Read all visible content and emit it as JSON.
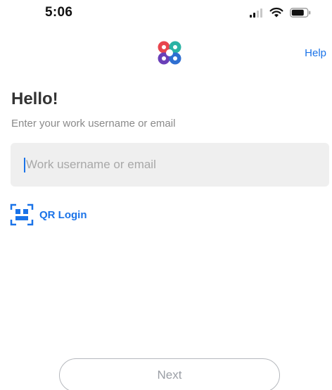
{
  "status_bar": {
    "time": "5:06",
    "signal_icon": "cellular-signal-icon",
    "wifi_icon": "wifi-icon",
    "battery_icon": "battery-icon"
  },
  "header": {
    "logo_icon": "app-logo-icon",
    "help_label": "Help"
  },
  "greeting": {
    "title": "Hello!",
    "subtitle": "Enter your work username or email"
  },
  "username": {
    "value": "",
    "placeholder": "Work username or email"
  },
  "qr_login": {
    "icon": "qr-code-icon",
    "label": "QR Login"
  },
  "next_button": {
    "label": "Next",
    "enabled": false
  },
  "colors": {
    "accent": "#1a73e8",
    "logo_red": "#e8454d",
    "logo_teal": "#2bb3a4",
    "logo_blue": "#2e6fd1",
    "logo_purple": "#6a3fb8"
  }
}
